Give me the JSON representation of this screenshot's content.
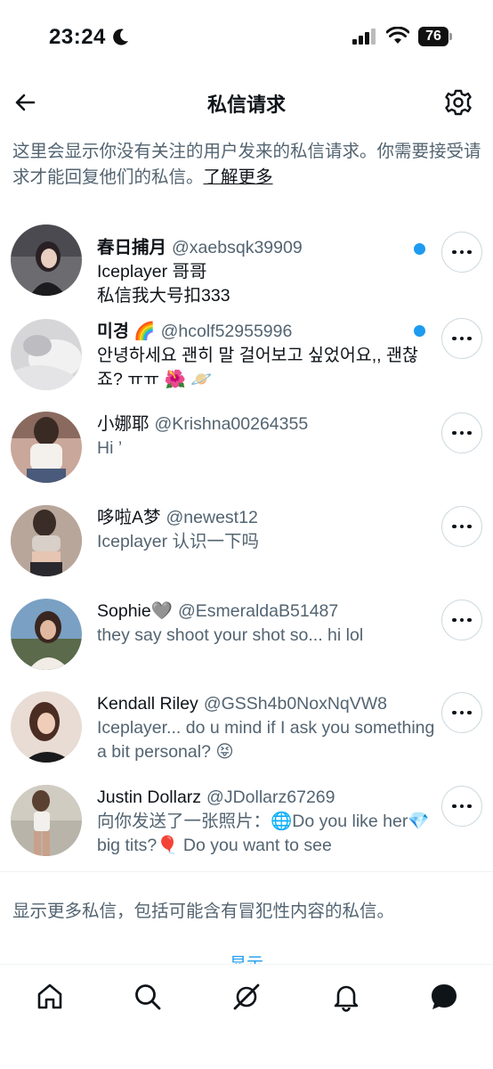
{
  "status_bar": {
    "time": "23:24",
    "battery": "76"
  },
  "header": {
    "title": "私信请求"
  },
  "intro": {
    "text": "这里会显示你没有关注的用户发来的私信请求。你需要接受请求才能回复他们的私信。",
    "link": "了解更多"
  },
  "requests": [
    {
      "name": "春日捕月",
      "handle": "@xaebsqk39909",
      "message": "Iceplayer 哥哥\n私信我大号扣333",
      "unread": true
    },
    {
      "name": "미경 🌈",
      "handle": "@hcolf52955996",
      "message": "안녕하세요 괜히 말 걸어보고 싶었어요,, 괜찮죠? ㅠㅠ 🌺 🪐",
      "unread": true
    },
    {
      "name": "小娜耶",
      "handle": "@Krishna00264355",
      "message": "Hi ’",
      "unread": false
    },
    {
      "name": "哆啦A梦",
      "handle": "@newest12",
      "message": "Iceplayer 认识一下吗",
      "unread": false
    },
    {
      "name": "Sophie🩶",
      "handle": "@EsmeraldaB51487",
      "message": "they say shoot your shot so... hi lol",
      "unread": false
    },
    {
      "name": "Kendall Riley",
      "handle": "@GSSh4b0NoxNqVW8",
      "message": "Iceplayer... do u mind if I ask you something a bit personal? 😝",
      "unread": false
    },
    {
      "name": "Justin Dollarz",
      "handle": "@JDollarz67269",
      "message": "向你发送了一张照片：🌐Do you like her💎 big tits?🎈 Do you want to see",
      "unread": false
    }
  ],
  "show_more": {
    "text": "显示更多私信，包括可能含有冒犯性内容的私信。",
    "link": "显示"
  },
  "bottom_nav": {
    "items": [
      "home-icon",
      "search-icon",
      "grok-icon",
      "notifications-icon",
      "messages-icon"
    ]
  },
  "colors": {
    "accent": "#1d9bf0",
    "text_primary": "#0f1419",
    "text_secondary": "#536471",
    "border": "#cfd9de"
  }
}
